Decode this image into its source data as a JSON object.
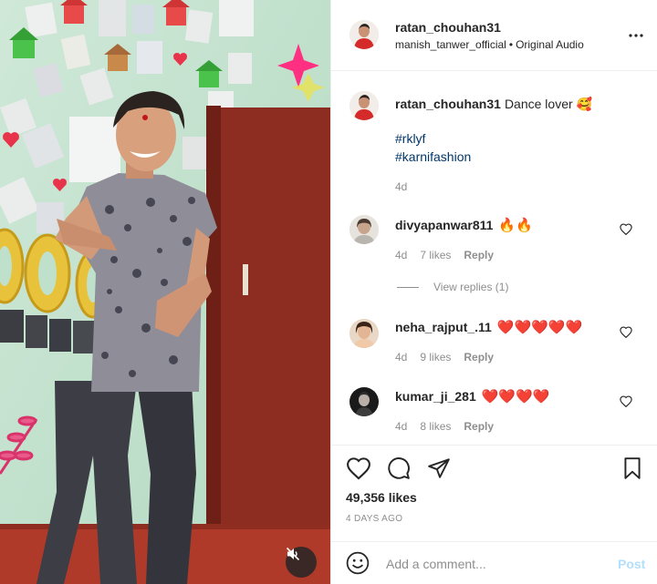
{
  "post": {
    "username": "ratan_chouhan31",
    "audio_author": "manish_tanwer_official",
    "audio_separator": "•",
    "audio_label": "Original Audio",
    "more_icon": "more-horizontal-icon"
  },
  "caption": {
    "username": "ratan_chouhan31",
    "text": "Dance lover 🥰",
    "hashtags": [
      "#rklyf",
      "#karnifashion"
    ],
    "time": "4d"
  },
  "comments": [
    {
      "username": "divyapanwar811",
      "text": "🔥🔥",
      "time": "4d",
      "likes": "7 likes",
      "reply": "Reply",
      "view_replies": "View replies (1)"
    },
    {
      "username": "neha_rajput_.11",
      "text": "❤️❤️❤️❤️❤️",
      "time": "4d",
      "likes": "9 likes",
      "reply": "Reply"
    },
    {
      "username": "kumar_ji_281",
      "text": "❤️❤️❤️❤️",
      "time": "4d",
      "likes": "8 likes",
      "reply": "Reply"
    }
  ],
  "stats": {
    "likes": "49,356 likes",
    "posted": "4 DAYS AGO"
  },
  "add_comment": {
    "placeholder": "Add a comment...",
    "post_label": "Post"
  },
  "colors": {
    "link": "#00376b",
    "muted": "#8e8e8e",
    "post_disabled": "#b2dffc",
    "wall": "#b9dcc6",
    "door": "#8a2a20"
  }
}
